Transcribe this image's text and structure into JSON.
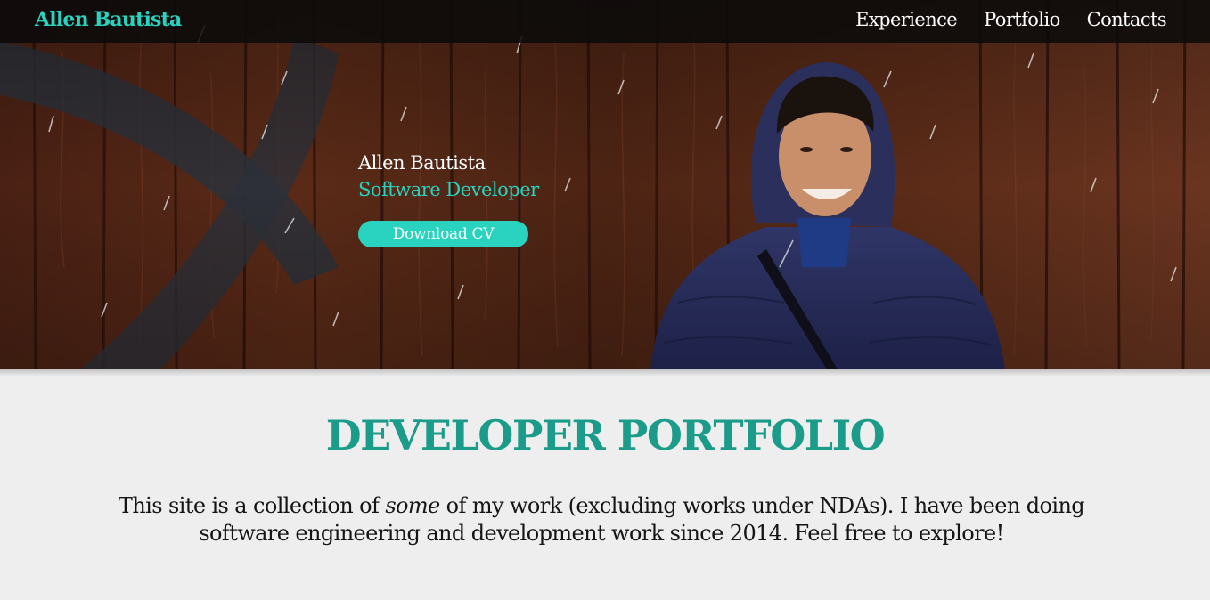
{
  "navbar": {
    "brand": "Allen Bautista",
    "links": [
      "Experience",
      "Portfolio",
      "Contacts"
    ]
  },
  "hero": {
    "name": "Allen Bautista",
    "role": "Software Developer",
    "cv_button": "Download CV"
  },
  "section": {
    "title": "DEVELOPER PORTFOLIO",
    "intro_before": "This site is a collection of ",
    "intro_emphasis": "some",
    "intro_after": " of my work (excluding works under NDAs). I have been doing software engineering and development work since 2014. Feel free to explore!"
  },
  "colors": {
    "accent": "#2ad3bf",
    "title": "#1b9c8a",
    "page_background": "#efeeef",
    "navbar": "#0a0a0a"
  }
}
